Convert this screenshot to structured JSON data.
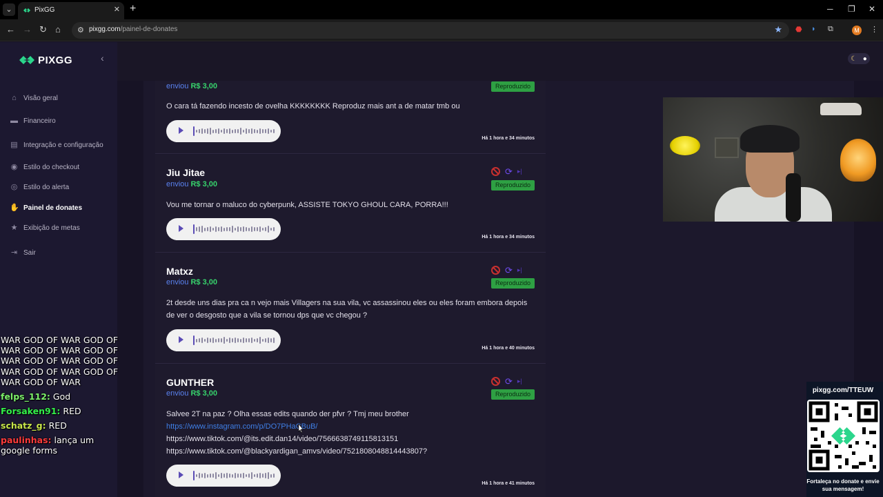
{
  "browser": {
    "tab_title": "PixGG",
    "url_domain": "pixgg.com",
    "url_path": "/painel-de-donates",
    "profile_initial": "M"
  },
  "sidebar": {
    "logo": "PIXGG",
    "items": [
      {
        "label": "Visão geral",
        "icon": "home-icon"
      },
      {
        "label": "Financeiro",
        "icon": "wallet-icon"
      },
      {
        "label": "Integração e configuração",
        "icon": "settings-icon"
      },
      {
        "label": "Estilo do checkout",
        "icon": "palette-icon"
      },
      {
        "label": "Estilo do alerta",
        "icon": "palette-icon"
      },
      {
        "label": "Painel de donates",
        "icon": "donate-icon",
        "active": true
      },
      {
        "label": "Exibição de metas",
        "icon": "star-icon"
      },
      {
        "label": "Sair",
        "icon": "logout-icon"
      }
    ]
  },
  "donations": [
    {
      "name": "",
      "sent_label": "enviou",
      "amount": "R$ 3,00",
      "status": "Reproduzido",
      "message": "O cara tá fazendo incesto de ovelha KKKKKKKK Reproduz mais ant a de matar tmb ou",
      "time": "Há 1 hora e 34 minutos"
    },
    {
      "name": "Jiu Jitae",
      "sent_label": "enviou",
      "amount": "R$ 3,00",
      "status": "Reproduzido",
      "message": "Vou me tornar o maluco do cyberpunk, ASSISTE TOKYO GHOUL CARA, PORRA!!!",
      "time": "Há 1 hora e 34 minutos"
    },
    {
      "name": "Matxz",
      "sent_label": "enviou",
      "amount": "R$ 3,00",
      "status": "Reproduzido",
      "message": "2t desde uns dias pra ca n vejo mais Villagers na sua vila, vc assassinou eles ou eles foram embora depois de ver o desgosto que a vila se tornou dps que vc chegou ?",
      "time": "Há 1 hora e 40 minutos"
    },
    {
      "name": "GUNTHER",
      "sent_label": "enviou",
      "amount": "R$ 3,00",
      "status": "Reproduzido",
      "message": "Salvee 2T na paz ? Olha essas edits quando der pfvr ? Tmj meu brother",
      "link1": "https://www.instagram.com/p/DO7PHaCBuB/",
      "link2": "https://www.tiktok.com/@its.edit.dan14/video/7566638749115813151",
      "link3": "https://www.tiktok.com/@blackyardigan_amvs/video/7521808048814443807?",
      "time": "Há 1 hora e 41 minutos"
    }
  ],
  "chat": {
    "spam": "WAR GOD OF WAR GOD OF WAR GOD OF WAR GOD OF WAR GOD OF WAR GOD OF WAR GOD OF WAR GOD OF WAR GOD OF WAR",
    "messages": [
      {
        "user": "felps_112:",
        "text": "God",
        "color": "#7df06a"
      },
      {
        "user": "Forsaken91:",
        "text": "RED",
        "color": "#34f04a"
      },
      {
        "user": "schatz_g:",
        "text": "RED",
        "color": "#c8e64a"
      },
      {
        "user": "paulinhas:",
        "text": "lança um google forms",
        "color": "#ff3b3b"
      }
    ]
  },
  "qr_widget": {
    "url": "pixgg.com/TTEUW",
    "caption": "Fortaleça no donate e envie sua mensagem!"
  },
  "colors": {
    "accent_green": "#37d36c",
    "badge_green": "#2ea043",
    "link_blue": "#3f7fe6"
  }
}
